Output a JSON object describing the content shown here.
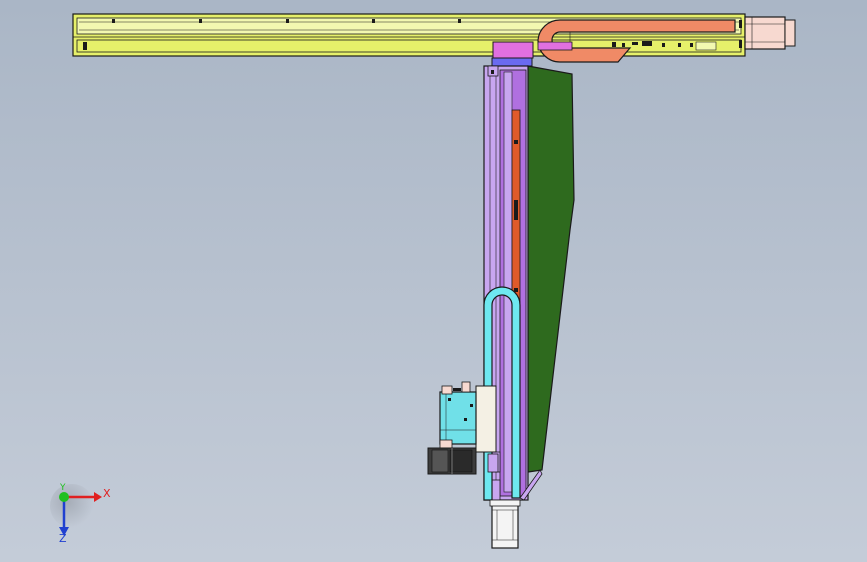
{
  "viewport": {
    "background_top": "#aab6c6",
    "background_bottom": "#c4ccd8"
  },
  "triad": {
    "x_label": "X",
    "y_label": "Y",
    "z_label": "Z",
    "x_color": "#e02020",
    "y_color": "#20c020",
    "z_color": "#2040d0"
  },
  "model": {
    "colors": {
      "outline": "#1a1a1a",
      "x_rail": "#e6f06a",
      "x_rail_light": "#f2f8b0",
      "motor_housing": "#f7d9d0",
      "cable_chain_x": "#f08a66",
      "cable_chain_z": "#6ee8f0",
      "carriage_plate": "#e070e0",
      "carriage_block": "#6a6af0",
      "z_column": "#c8a6f0",
      "z_inner": "#b070e0",
      "z_strip": "#e05a2a",
      "side_plate": "#2e6a1e",
      "gripper_body": "#70e0e8",
      "gripper_mount": "#f4f0e4",
      "cylinder": "#3c3c3c",
      "bottom_motor": "#f4f4f4"
    }
  }
}
